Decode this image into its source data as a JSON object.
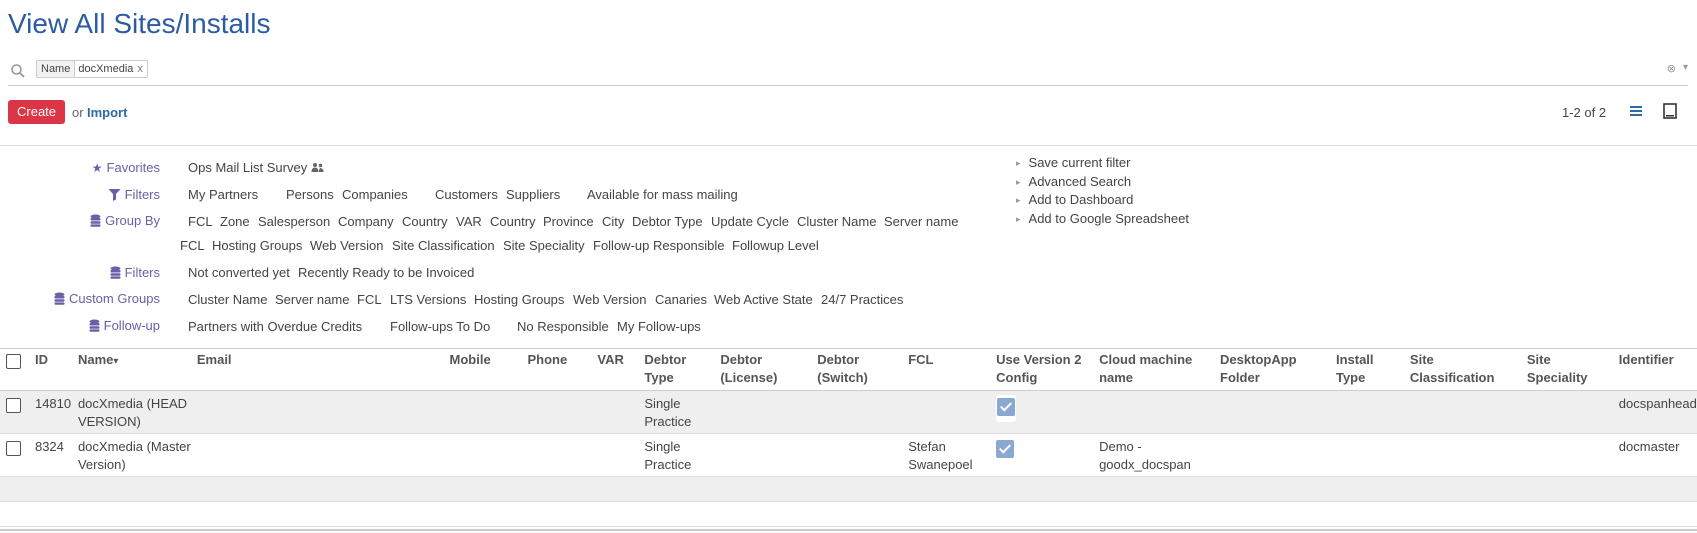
{
  "page": {
    "title": "View All Sites/Installs"
  },
  "search": {
    "facet_label": "Name",
    "facet_value": "docXmedia",
    "facet_close": "x",
    "clear_glyph": "⊗",
    "dropdown_glyph": "▾"
  },
  "toolbar": {
    "create_label": "Create",
    "or_text": "or",
    "import_label": "Import",
    "pager": "1-2 of 2"
  },
  "panel": {
    "favorites": {
      "label": "Favorites",
      "items": [
        "Ops Mail List Survey"
      ]
    },
    "filters": {
      "label": "Filters",
      "items": [
        "My Partners",
        "Persons",
        "Companies",
        "Customers",
        "Suppliers",
        "Available for mass mailing"
      ]
    },
    "group_by": {
      "label": "Group By",
      "items": [
        "FCL",
        "Zone",
        "Salesperson",
        "Company",
        "Country",
        "VAR",
        "Country",
        "Province",
        "City",
        "Debtor Type",
        "Update Cycle",
        "Cluster Name",
        "Server name",
        "FCL",
        "Hosting Groups",
        "Web Version",
        "Site Classification",
        "Site Speciality",
        "Follow-up Responsible",
        "Followup Level"
      ]
    },
    "filters2": {
      "label": "Filters",
      "items": [
        "Not converted yet",
        "Recently Ready to be Invoiced"
      ]
    },
    "custom_groups": {
      "label": "Custom Groups",
      "items": [
        "Cluster Name",
        "Server name",
        "FCL",
        "LTS Versions",
        "Hosting Groups",
        "Web Version",
        "Canaries",
        "Web Active State",
        "24/7 Practices"
      ]
    },
    "follow_up": {
      "label": "Follow-up",
      "items": [
        "Partners with Overdue Credits",
        "Follow-ups To Do",
        "No Responsible",
        "My Follow-ups"
      ]
    },
    "side_links": [
      "Save current filter",
      "Advanced Search",
      "Add to Dashboard",
      "Add to Google Spreadsheet"
    ]
  },
  "table": {
    "columns": [
      {
        "l1": "ID",
        "l2": ""
      },
      {
        "l1": "Name",
        "l2": ""
      },
      {
        "l1": "Email",
        "l2": ""
      },
      {
        "l1": "Mobile",
        "l2": ""
      },
      {
        "l1": "Phone",
        "l2": ""
      },
      {
        "l1": "VAR",
        "l2": ""
      },
      {
        "l1": "Debtor",
        "l2": "Type"
      },
      {
        "l1": "Debtor",
        "l2": "(License)"
      },
      {
        "l1": "Debtor",
        "l2": "(Switch)"
      },
      {
        "l1": "FCL",
        "l2": ""
      },
      {
        "l1": "Use Version 2",
        "l2": "Config"
      },
      {
        "l1": "Cloud machine",
        "l2": "name"
      },
      {
        "l1": "DesktopApp",
        "l2": "Folder"
      },
      {
        "l1": "Install",
        "l2": "Type"
      },
      {
        "l1": "Site",
        "l2": "Classification"
      },
      {
        "l1": "Site",
        "l2": "Speciality"
      },
      {
        "l1": "Identifier",
        "l2": ""
      }
    ],
    "sort_glyph": "▾",
    "rows": [
      {
        "id": "14810",
        "name_l1": "docXmedia (HEAD",
        "name_l2": "VERSION)",
        "debtor_l1": "Single",
        "debtor_l2": "Practice",
        "fcl_l1": "",
        "fcl_l2": "",
        "use_v2": true,
        "cloud_l1": "",
        "cloud_l2": "",
        "identifier": "docspanhead"
      },
      {
        "id": "8324",
        "name_l1": "docXmedia (Master",
        "name_l2": "Version)",
        "debtor_l1": "Single",
        "debtor_l2": "Practice",
        "fcl_l1": "Stefan",
        "fcl_l2": "Swanepoel",
        "use_v2": true,
        "cloud_l1": "Demo -",
        "cloud_l2": "goodx_docspan",
        "identifier": "docmaster"
      }
    ]
  }
}
